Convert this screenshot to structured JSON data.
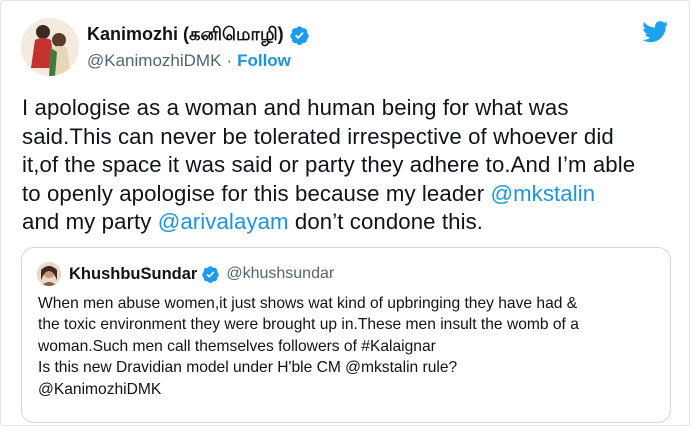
{
  "author": {
    "display_name": "Kanimozhi (கனிமொழி)",
    "handle": "@KanimozhiDMK",
    "separator": "·",
    "follow_label": "Follow"
  },
  "tweet": {
    "lines": [
      "I apologise as a woman and human being for what was",
      "said.This can never be tolerated irrespective of whoever did",
      "it,of the space it was said or party they adhere to.And I’m able",
      "to openly apologise for this because my leader "
    ],
    "mention_1": "@mkstalin",
    "line5_prefix": "and my party ",
    "mention_2": "@arivalayam",
    "line5_suffix": " don’t condone this."
  },
  "quoted_tweet": {
    "display_name": "KhushbuSundar",
    "handle": "@khushsundar",
    "lines": [
      "When men abuse women,it just shows wat kind of upbringing they have had &",
      "the toxic environment they were brought up in.These men insult the womb of a",
      "woman.Such men call themselves followers of #Kalaignar",
      "Is this new Dravidian model under H'ble CM @mkstalin rule?",
      "@KanimozhiDMK"
    ]
  },
  "icons": {
    "verified": "verified-badge-icon",
    "twitter": "twitter-bird-icon"
  },
  "colors": {
    "link": "#1b95e0",
    "verified": "#1d9bf0",
    "twitter_blue": "#1da1f2",
    "secondary_text": "#536471"
  }
}
